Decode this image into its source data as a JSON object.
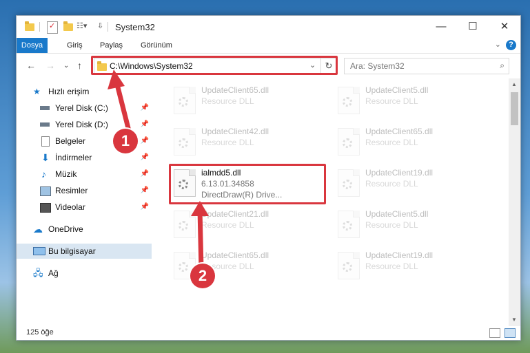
{
  "window": {
    "title": "System32",
    "minimize_glyph": "—",
    "maximize_glyph": "☐",
    "close_glyph": "✕"
  },
  "ribbon": {
    "tabs": [
      {
        "label": "Dosya",
        "active": true
      },
      {
        "label": "Giriş"
      },
      {
        "label": "Paylaş"
      },
      {
        "label": "Görünüm"
      }
    ],
    "help_glyph": "?"
  },
  "nav": {
    "address": "C:\\Windows\\System32",
    "search_placeholder": "Ara: System32"
  },
  "sidebar": {
    "items": [
      {
        "label": "Hızlı erişim",
        "icon": "star-icon"
      },
      {
        "label": "Yerel Disk (C:)",
        "icon": "drive-icon",
        "pinned": true
      },
      {
        "label": "Yerel Disk (D:)",
        "icon": "drive-icon",
        "pinned": true
      },
      {
        "label": "Belgeler",
        "icon": "documents-icon",
        "pinned": true
      },
      {
        "label": "İndirmeler",
        "icon": "download-icon",
        "pinned": true
      },
      {
        "label": "Müzik",
        "icon": "music-icon",
        "pinned": true
      },
      {
        "label": "Resimler",
        "icon": "pictures-icon",
        "pinned": true
      },
      {
        "label": "Videolar",
        "icon": "videos-icon",
        "pinned": true
      },
      {
        "label": "OneDrive",
        "icon": "cloud-icon"
      },
      {
        "label": "Bu bilgisayar",
        "icon": "computer-icon",
        "selected": true
      },
      {
        "label": "Ağ",
        "icon": "network-icon"
      }
    ]
  },
  "files": [
    {
      "name": "UpdateClient65.dll",
      "desc": "Resource DLL"
    },
    {
      "name": "UpdateClient5.dll",
      "desc": "Resource DLL"
    },
    {
      "name": "UpdateClient42.dll",
      "desc": "Resource DLL"
    },
    {
      "name": "UpdateClient65.dll",
      "desc": "Resource DLL"
    },
    {
      "name": "ialmdd5.dll",
      "desc": "6.13.01.34858",
      "desc2": "DirectDraw(R) Drive...",
      "highlighted": true
    },
    {
      "name": "UpdateClient19.dll",
      "desc": "Resource DLL"
    },
    {
      "name": "UpdateClient21.dll",
      "desc": "Resource DLL"
    },
    {
      "name": "UpdateClient5.dll",
      "desc": "Resource DLL"
    },
    {
      "name": "UpdateClient65.dll",
      "desc": "Resource DLL"
    },
    {
      "name": "UpdateClient19.dll",
      "desc": "Resource DLL"
    }
  ],
  "status": {
    "item_count": "125 öğe"
  },
  "callouts": {
    "one": "1",
    "two": "2"
  },
  "colors": {
    "accent": "#1979ca",
    "highlight": "#d9363e",
    "selected_bg": "#d9e6f2"
  }
}
